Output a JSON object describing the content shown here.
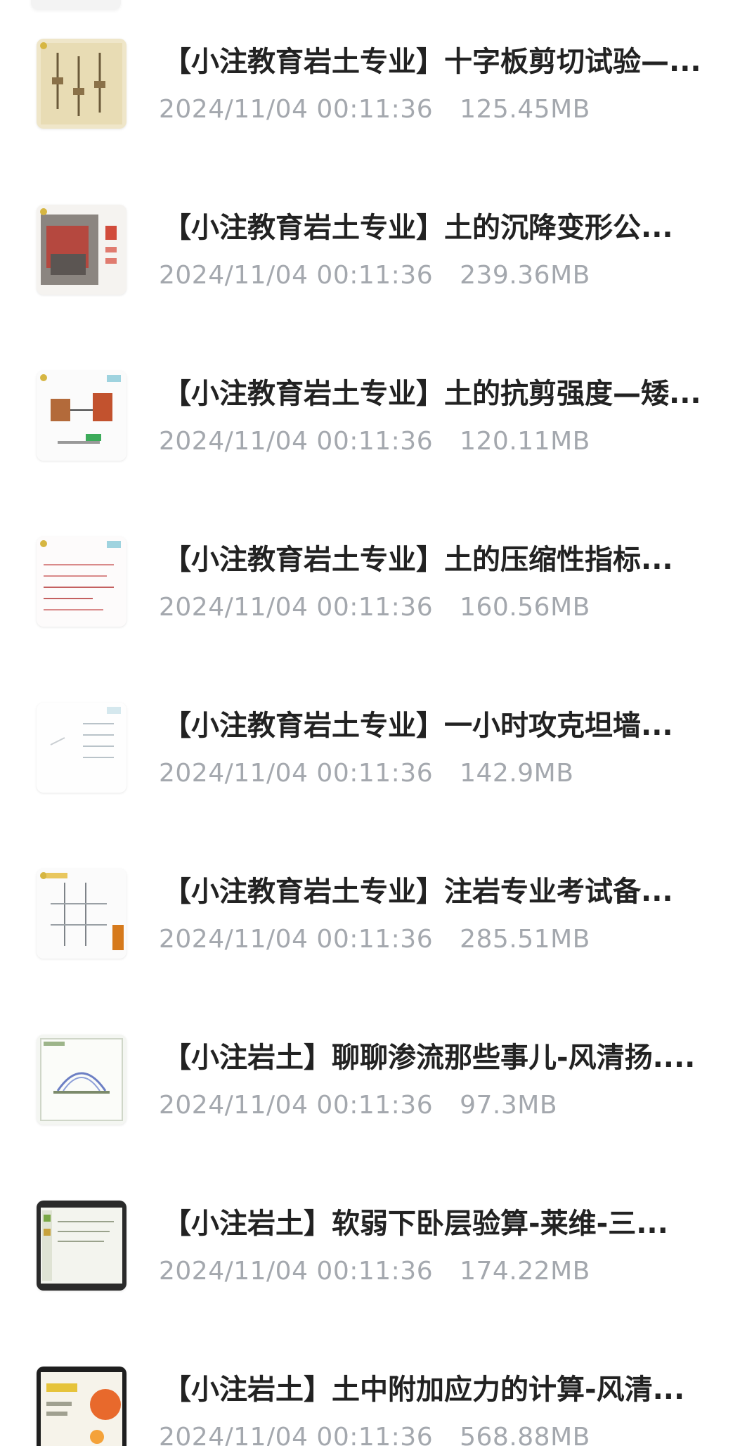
{
  "files": [
    {
      "title": "【小注教育岩土专业】十字板剪切试验—...",
      "date": "2024/11/04 00:11:36",
      "size": "125.45MB"
    },
    {
      "title": "【小注教育岩土专业】土的沉降变形公...",
      "date": "2024/11/04 00:11:36",
      "size": "239.36MB"
    },
    {
      "title": "【小注教育岩土专业】土的抗剪强度—矮...",
      "date": "2024/11/04 00:11:36",
      "size": "120.11MB"
    },
    {
      "title": "【小注教育岩土专业】土的压缩性指标...",
      "date": "2024/11/04 00:11:36",
      "size": "160.56MB"
    },
    {
      "title": "【小注教育岩土专业】一小时攻克坦墙...",
      "date": "2024/11/04 00:11:36",
      "size": "142.9MB"
    },
    {
      "title": "【小注教育岩土专业】注岩专业考试备...",
      "date": "2024/11/04 00:11:36",
      "size": "285.51MB"
    },
    {
      "title": "【小注岩土】聊聊渗流那些事儿-风清扬....",
      "date": "2024/11/04 00:11:36",
      "size": "97.3MB"
    },
    {
      "title": "【小注岩土】软弱下卧层验算-莱维-三...",
      "date": "2024/11/04 00:11:36",
      "size": "174.22MB"
    },
    {
      "title": "【小注岩土】土中附加应力的计算-风清...",
      "date": "2024/11/04 00:11:36",
      "size": "568.88MB"
    }
  ]
}
